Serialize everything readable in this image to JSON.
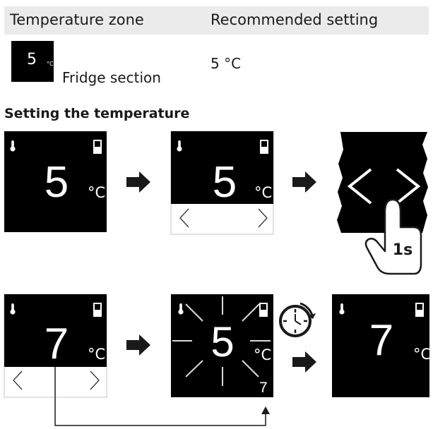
{
  "table": {
    "header_zone": "Temperature zone",
    "header_setting": "Recommended setting",
    "row": {
      "chip_value": "5",
      "chip_unit": "°C",
      "zone": "Fridge section",
      "setting": "5 °C"
    }
  },
  "section_title": "Setting the temperature",
  "steps": {
    "display_values": [
      "5",
      "5",
      "7",
      "5",
      "7"
    ],
    "display_unit": "°C",
    "hold_label": "1s",
    "new_value_small": "7",
    "nav_left": "<",
    "nav_right": ">"
  },
  "icons": [
    "thermometer-icon",
    "door-icon",
    "arrow-right-icon",
    "finger-press-icon",
    "clock-timer-icon",
    "chevron-left-icon",
    "chevron-right-icon"
  ]
}
